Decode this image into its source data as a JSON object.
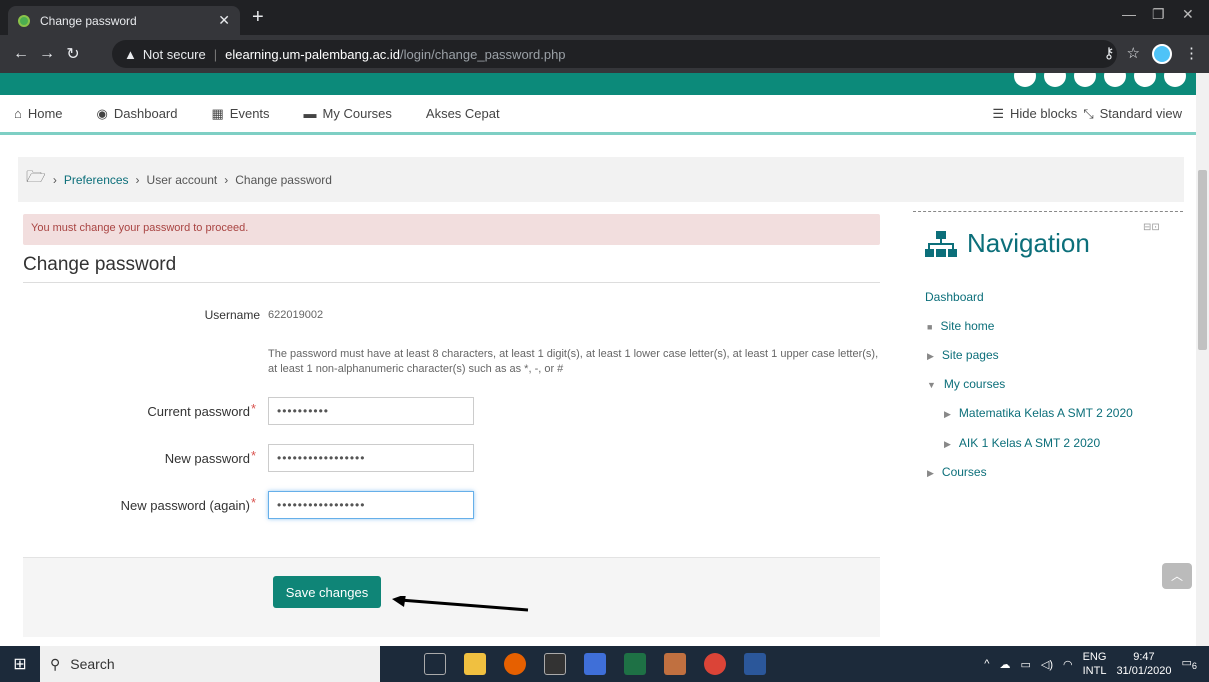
{
  "browser": {
    "tab_title": "Change password",
    "security_label": "Not secure",
    "url_host": "elearning.um-palembang.ac.id",
    "url_path": "/login/change_password.php"
  },
  "mainnav": {
    "home": "Home",
    "dashboard": "Dashboard",
    "events": "Events",
    "my_courses": "My Courses",
    "akses_cepat": "Akses Cepat",
    "hide_blocks": "Hide blocks",
    "standard_view": "Standard view"
  },
  "breadcrumb": {
    "preferences": "Preferences",
    "user_account": "User account",
    "change_password": "Change password"
  },
  "alert": "You must change your password to proceed.",
  "form": {
    "heading": "Change password",
    "username_label": "Username",
    "username_value": "622019002",
    "rule": "The password must have at least 8 characters, at least 1 digit(s), at least 1 lower case letter(s), at least 1 upper case letter(s), at least 1 non-alphanumeric character(s) such as as *, -, or #",
    "current_label": "Current password",
    "current_value": "••••••••••",
    "new_label": "New password",
    "new_value": "•••••••••••••••••",
    "again_label": "New password (again)",
    "again_value": "•••••••••••••••••",
    "required_mark": "*",
    "save_label": "Save changes"
  },
  "navigation": {
    "title": "Navigation",
    "dashboard": "Dashboard",
    "site_home": "Site home",
    "site_pages": "Site pages",
    "my_courses": "My courses",
    "course1": "Matematika Kelas A SMT 2 2020",
    "course2": "AIK 1 Kelas A SMT 2 2020",
    "courses": "Courses"
  },
  "taskbar": {
    "search": "Search",
    "lang1": "ENG",
    "lang2": "INTL",
    "time": "9:47",
    "date": "31/01/2020",
    "notif_count": "6"
  }
}
